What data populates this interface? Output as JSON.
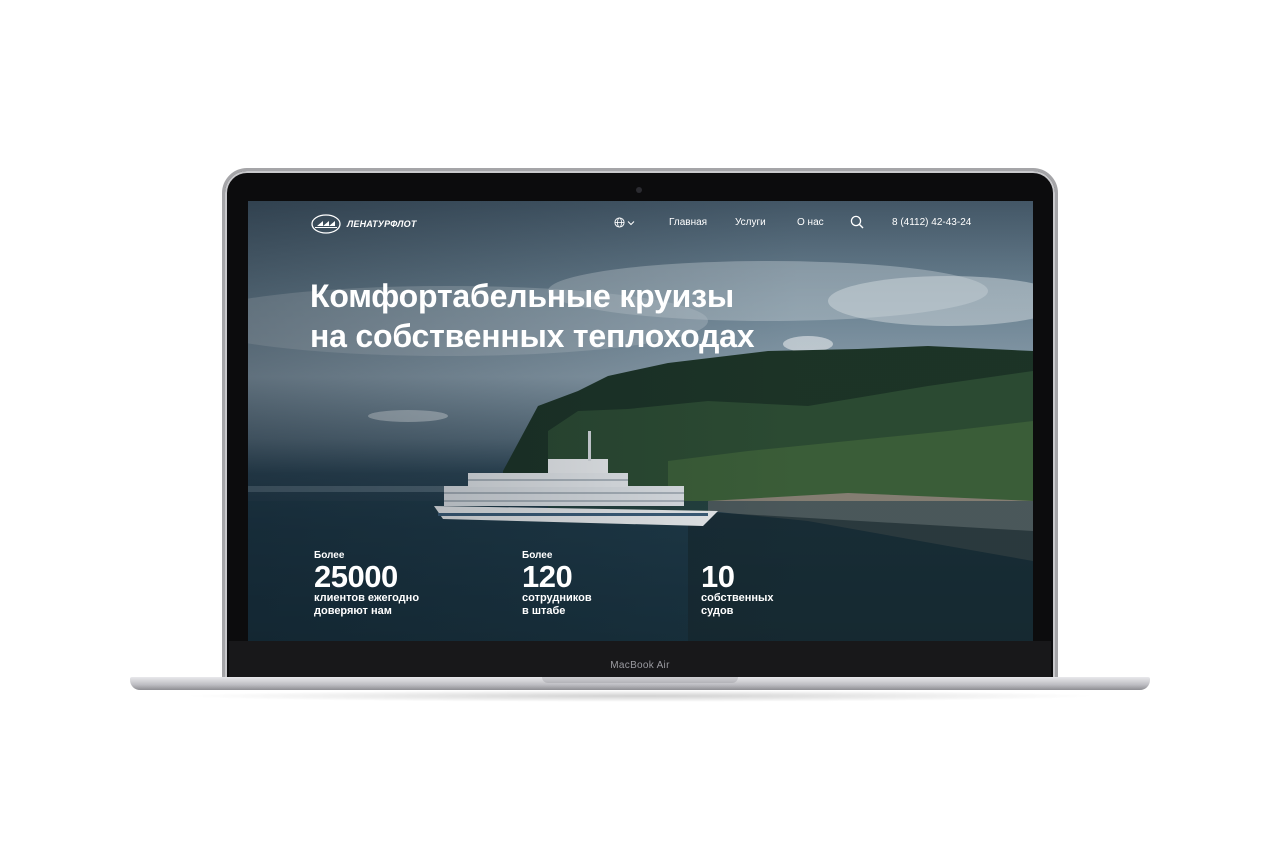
{
  "site": {
    "brand": "ЛЕНАТУРФЛОТ",
    "nav": {
      "language_icon": "globe-icon",
      "items": [
        "Главная",
        "Услуги",
        "О нас"
      ],
      "search_icon": "search-icon",
      "phone": "8 (4112) 42-43-24"
    },
    "hero": {
      "title_line1": "Комфортабельные круизы",
      "title_line2": "на собственных теплоходах"
    },
    "stats": [
      {
        "prefix": "Более",
        "number": "25000",
        "caption_line1": "клиентов ежегодно",
        "caption_line2": "доверяют нам"
      },
      {
        "prefix": "Более",
        "number": "120",
        "caption_line1": "сотрудников",
        "caption_line2": "в штабе"
      },
      {
        "prefix": "",
        "number": "10",
        "caption_line1": "собственных",
        "caption_line2": "судов"
      }
    ]
  },
  "device": {
    "model_label": "MacBook Air"
  },
  "colors": {
    "text": "#ffffff",
    "bezel": "#0c0c0d",
    "aluminum": "#c9c9cc"
  }
}
